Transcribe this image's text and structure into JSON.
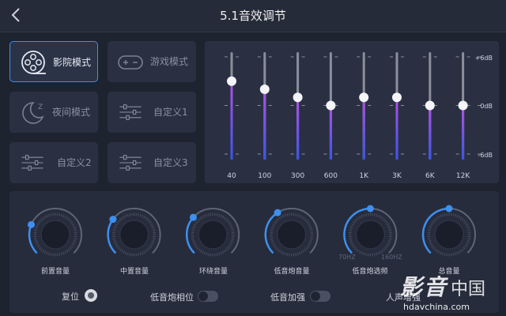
{
  "header": {
    "title": "5.1音效调节",
    "back_icon": "chevron-left-icon"
  },
  "modes": [
    {
      "label": "影院模式",
      "icon": "film-reel-icon",
      "active": true
    },
    {
      "label": "游戏模式",
      "icon": "gamepad-icon",
      "active": false
    },
    {
      "label": "夜间模式",
      "icon": "moon-icon",
      "active": false
    },
    {
      "label": "自定义1",
      "icon": "sliders-icon",
      "active": false
    },
    {
      "label": "自定义2",
      "icon": "sliders-icon",
      "active": false
    },
    {
      "label": "自定义3",
      "icon": "sliders-icon",
      "active": false
    }
  ],
  "equalizer": {
    "scale": {
      "top": "+6dB",
      "mid": "0dB",
      "bottom": "-6dB"
    },
    "range_db": [
      -6,
      6
    ],
    "bands": [
      {
        "label": "40",
        "gain_db": 3
      },
      {
        "label": "100",
        "gain_db": 2
      },
      {
        "label": "300",
        "gain_db": 1
      },
      {
        "label": "600",
        "gain_db": 0
      },
      {
        "label": "1K",
        "gain_db": 1
      },
      {
        "label": "3K",
        "gain_db": 1
      },
      {
        "label": "6K",
        "gain_db": 0
      },
      {
        "label": "12K",
        "gain_db": 0
      }
    ]
  },
  "knobs": [
    {
      "label": "前置音量",
      "level": 0.25
    },
    {
      "label": "中置音量",
      "level": 0.3
    },
    {
      "label": "环绕音量",
      "level": 0.32
    },
    {
      "label": "低音炮音量",
      "level": 0.38
    },
    {
      "label": "低音炮选频",
      "level": 0.5,
      "min_label": "70HZ",
      "max_label": "160HZ"
    },
    {
      "label": "总音量",
      "level": 0.5
    }
  ],
  "controls": {
    "reset_label": "复位",
    "sub_phase_label": "低音炮相位",
    "sub_phase_on": false,
    "bass_boost_label": "低音加强",
    "bass_boost_on": false,
    "vocal_label": "人声增强"
  },
  "watermark": {
    "brand": "影音",
    "brand2": "中国",
    "url": "hdavchina.com"
  },
  "colors": {
    "accent": "#3d8ff0",
    "bar_top": "#b450e6",
    "bar_bottom": "#3a55ee"
  }
}
